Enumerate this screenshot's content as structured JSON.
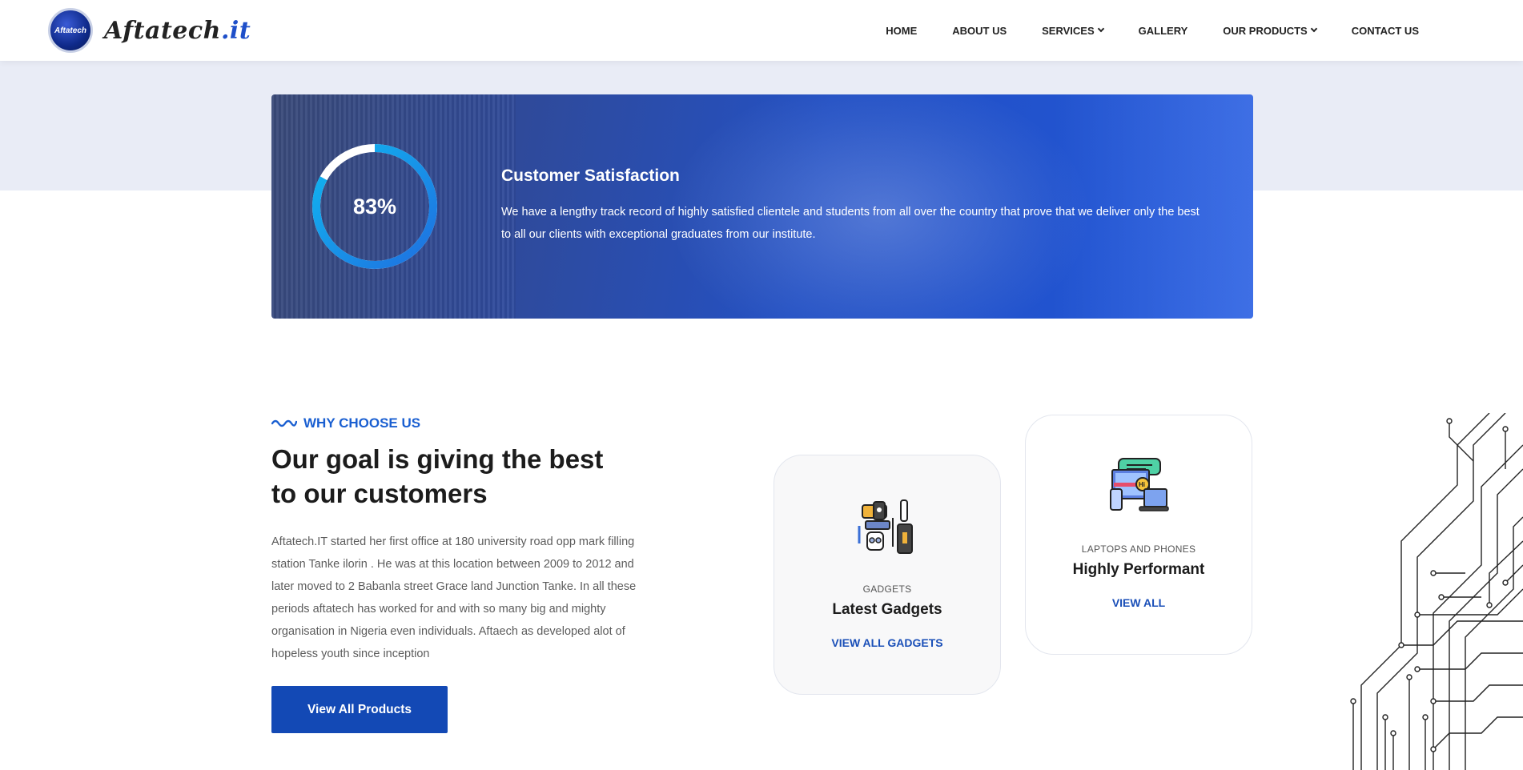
{
  "header": {
    "logo_badge_text": "Aftatech",
    "logo_text_main": "Aftatech",
    "logo_text_accent": ".it",
    "nav": [
      {
        "label": "HOME"
      },
      {
        "label": "ABOUT US"
      },
      {
        "label": "SERVICES"
      },
      {
        "label": "GALLERY"
      },
      {
        "label": "OUR PRODUCTS"
      },
      {
        "label": "CONTACT US"
      }
    ]
  },
  "hero": {
    "percent": 83,
    "percent_label": "83%",
    "title": "Customer Satisfaction",
    "text": "We have a lengthy track record of highly satisfied clientele and students from all over the country that prove that we deliver only the best to all our clients with exceptional graduates from our institute."
  },
  "why": {
    "eyebrow": "WHY CHOOSE US",
    "heading": "Our goal is giving the best to our customers",
    "description": "Aftatech.IT started her first office at 180 university road opp mark filling station Tanke ilorin . He was at this location between 2009 to 2012 and later moved to 2 Babanla street Grace land Junction Tanke. In all these periods aftatech has worked for and with so many big and mighty organisation in Nigeria even individuals. Aftaech as developed alot of hopeless youth since inception",
    "button_label": "View All Products"
  },
  "cards": [
    {
      "category": "GADGETS",
      "title": "Latest Gadgets",
      "link": "VIEW ALL GADGETS",
      "icon": "gadgets-icon"
    },
    {
      "category": "LAPTOPS AND PHONES",
      "title": "Highly Performant",
      "link": "VIEW ALL",
      "icon": "laptop-phone-icon"
    }
  ],
  "colors": {
    "accent": "#1349b5",
    "eyebrow": "#1a5fd1",
    "ring_start": "#1f6fe0",
    "ring_end": "#10b8f0"
  }
}
